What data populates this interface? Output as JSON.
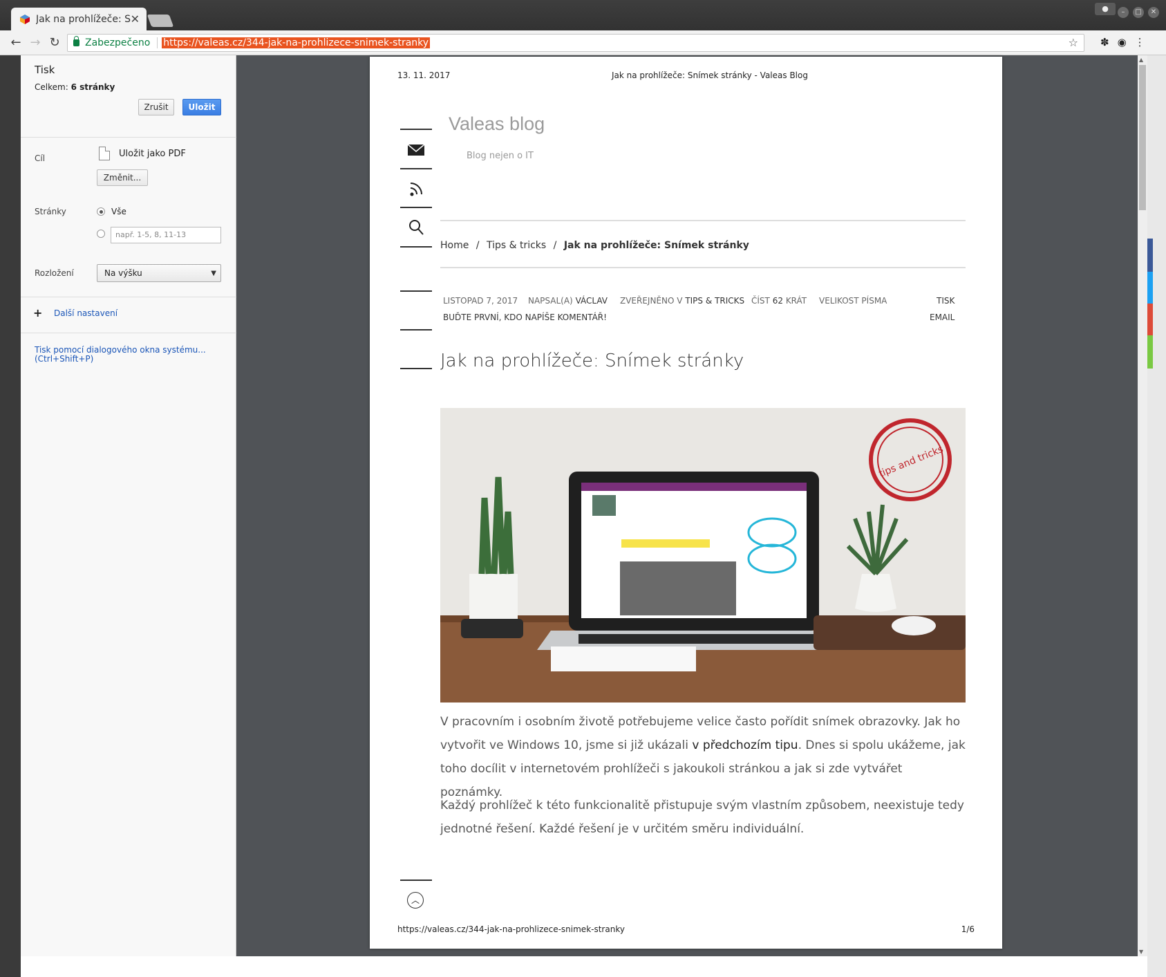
{
  "browser": {
    "tab_title": "Jak na prohlížeče: S",
    "secure_label": "Zabezpečeno",
    "url": "https://valeas.cz/344-jak-na-prohlizece-snimek-stranky"
  },
  "print_panel": {
    "title": "Tisk",
    "total_label": "Celkem:",
    "total_value": "6 stránky",
    "cancel_label": "Zrušit",
    "save_label": "Uložit",
    "destination_label": "Cíl",
    "destination_value": "Uložit jako PDF",
    "change_label": "Změnit...",
    "pages_label": "Stránky",
    "pages_all": "Vše",
    "pages_placeholder": "např. 1-5, 8, 11-13",
    "layout_label": "Rozložení",
    "layout_value": "Na výšku",
    "more_settings": "Další nastavení",
    "system_dialog": "Tisk pomocí dialogového okna systému...",
    "system_dialog_shortcut": "(Ctrl+Shift+P)"
  },
  "page": {
    "header_date": "13. 11. 2017",
    "header_title": "Jak na prohlížeče: Snímek stránky - Valeas Blog",
    "footer_url": "https://valeas.cz/344-jak-na-prohlizece-snimek-stranky",
    "footer_page": "1/6",
    "blog_title": "Valeas blog",
    "blog_subtitle": "Blog nejen o IT",
    "breadcrumbs": {
      "home": "Home",
      "sep": "/",
      "category": "Tips & tricks",
      "current": "Jak na prohlížeče: Snímek stránky"
    },
    "meta": {
      "date": "LISTOPAD 7, 2017",
      "author_label": "NAPSAL(A)",
      "author": "VÁCLAV",
      "published_label": "ZVEŘEJNĚNO V",
      "category": "TIPS & TRICKS",
      "read_label": "ČÍST",
      "read_count": "62",
      "read_suffix": "KRÁT",
      "font_size": "VELIKOST PÍSMA",
      "print": "TISK",
      "comment": "BUĎTE PRVNÍ, KDO NAPÍŠE KOMENTÁŘ!",
      "email": "EMAIL"
    },
    "article_title": "Jak na prohlížeče: Snímek stránky",
    "stamp_text": "tips and tricks",
    "para1_a": "V pracovním i osobním životě potřebujeme velice často pořídit snímek obrazovky. Jak ho vytvořit ve Windows 10, jsme si již ukázali ",
    "para1_link": "v předchozím tipu",
    "para1_b": ". Dnes si spolu ukážeme, jak toho docílit v internetovém prohlížeči s jakoukoli stránkou a jak si zde vytvářet poznámky.",
    "para2": "Každý prohlížeč k této funkcionalitě přistupuje svým vlastním způsobem, neexistuje tedy jednotné řešení. Každé řešení je v určitém směru individuální."
  },
  "colors": {
    "accent_blue": "#3a7ee3",
    "secure_green": "#0b8043",
    "url_highlight": "#e95420",
    "stamp_red": "#c0262d"
  }
}
